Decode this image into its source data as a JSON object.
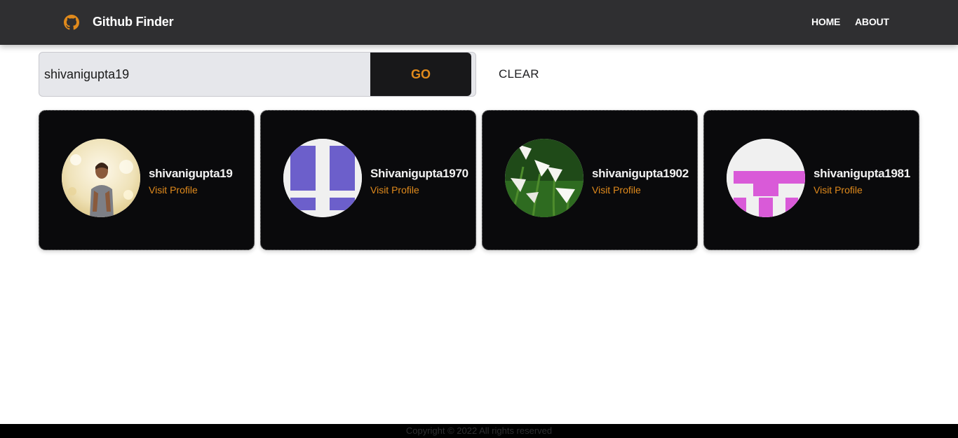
{
  "navbar": {
    "brand_title": "Github Finder",
    "brand_icon": "github-icon",
    "links": [
      {
        "label": "HOME"
      },
      {
        "label": "ABOUT"
      }
    ]
  },
  "search": {
    "value": "shivanigupta19",
    "go_label": "GO",
    "clear_label": "CLEAR"
  },
  "results": [
    {
      "username": "shivanigupta19",
      "link_label": "Visit Profile",
      "avatar": "photo-avatar"
    },
    {
      "username": "Shivanigupta1970",
      "link_label": "Visit Profile",
      "avatar": "identicon-purple"
    },
    {
      "username": "shivanigupta1902",
      "link_label": "Visit Profile",
      "avatar": "flowers-photo-avatar"
    },
    {
      "username": "shivanigupta1981",
      "link_label": "Visit Profile",
      "avatar": "identicon-magenta"
    }
  ],
  "footer": {
    "text": "Copyright © 2022 All rights reserved"
  },
  "colors": {
    "navbar_bg": "#2f2f31",
    "accent": "#e08a1c",
    "card_bg": "#0a0a0c",
    "identicon_purple": "#6c5fcb",
    "identicon_magenta": "#d95ad8"
  }
}
